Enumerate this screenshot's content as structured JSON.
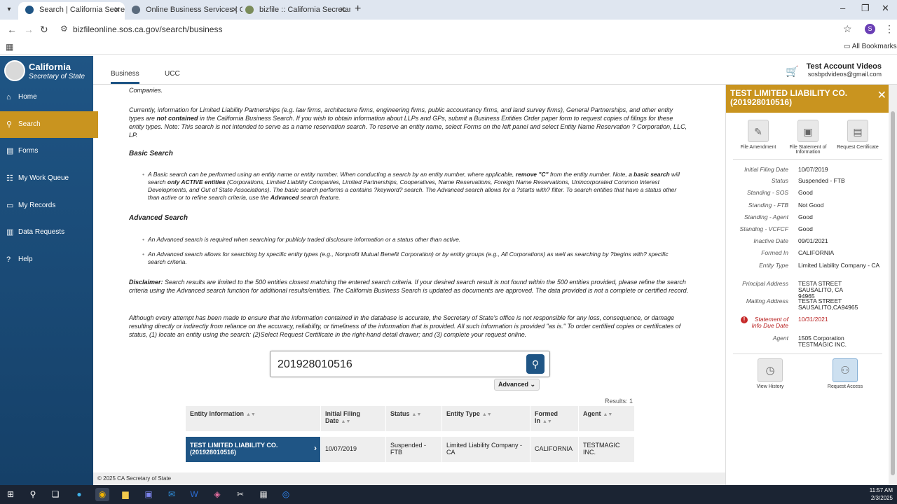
{
  "browser": {
    "tabs": [
      {
        "title": "Search | California Secretary of",
        "active": true
      },
      {
        "title": "Online Business Services | Calif",
        "active": false
      },
      {
        "title": "bizfile :: California Secretary of",
        "active": false
      }
    ],
    "url": "bizfileonline.sos.ca.gov/search/business",
    "profile_initial": "S",
    "all_bookmarks": "All Bookmarks"
  },
  "brand": {
    "name": "California",
    "subtitle": "Secretary of State"
  },
  "sidebar": {
    "items": [
      {
        "label": "Home",
        "icon": "home-icon"
      },
      {
        "label": "Search",
        "icon": "search-icon",
        "active": true
      },
      {
        "label": "Forms",
        "icon": "forms-icon"
      },
      {
        "label": "My Work Queue",
        "icon": "work-queue-icon"
      },
      {
        "label": "My Records",
        "icon": "records-icon"
      },
      {
        "label": "Data Requests",
        "icon": "data-icon"
      },
      {
        "label": "Help",
        "icon": "help-icon"
      }
    ]
  },
  "topnav": {
    "tabs": [
      "Business",
      "UCC"
    ],
    "account_name": "Test Account Videos",
    "account_email": "sosbpdvideos@gmail.com"
  },
  "main": {
    "top_fragment": "Companies.",
    "para1_a": "Currently, information for Limited Liability Partnerships (e.g. law firms, architecture firms, engineering firms, public accountancy firms, and land survey firms), General Partnerships, and other entity types are ",
    "para1_bold": "not contained",
    "para1_b": " in the California Business Search. If you wish to obtain information about LLPs and GPs, submit a Business Entities Order paper form to request copies of filings for these entity types. Note: This search is not intended to serve as a name reservation search. To reserve an entity name, select Forms on the left panel and select Entity Name Reservation ? Corporation, LLC, LP.",
    "basic_heading": "Basic Search",
    "basic_1": "A Basic search can be performed using an entity name or entity number. When conducting a search by an entity number, where applicable, ",
    "basic_b1": "remove \"C\"",
    "basic_2": " from the entity number. Note, ",
    "basic_b2": "a basic search",
    "basic_3": " will search ",
    "basic_b3": "only ACTIVE entities",
    "basic_4": " (Corporations, Limited Liability Companies, Limited Partnerships, Cooperatives, Name Reservations, Foreign Name Reservations, Unincorporated Common Interest Developments, and Out of State Associations). The basic search performs a contains ?keyword? search. The Advanced search allows for a ?starts with? filter. To search entities that have a status other than active or to refine search criteria, use the ",
    "basic_b4": "Advanced",
    "basic_5": " search feature.",
    "adv_heading": "Advanced Search",
    "adv_1": "An Advanced search is required when searching for publicly traded disclosure information or a status other than active.",
    "adv_2": "An Advanced search allows for searching by specific entity types (e.g., Nonprofit Mutual Benefit Corporation) or by entity groups (e.g., All Corporations) as well as searching by ?begins with? specific search criteria.",
    "disclaimer_label": "Disclaimer:",
    "disclaimer": " Search results are limited to the 500 entities closest matching the entered search criteria. If your desired search result is not found within the 500 entities provided, please refine the search criteria using the Advanced search function for additional results/entities. The California Business Search is updated as documents are approved. The data provided is not a complete or certified record.",
    "para_last": "Although every attempt has been made to ensure that the information contained in the database is accurate, the Secretary of State's office is not responsible for any loss, consequence, or damage resulting directly or indirectly from reliance on the accuracy, reliability, or timeliness of the information that is provided. All such information is provided \"as is.\" To order certified copies or certificates of status, (1) locate an entity using the search: (2)Select Request Certificate in the right-hand detail drawer; and (3) complete your request online.",
    "search_value": "201928010516",
    "advanced_label": "Advanced",
    "results_count": "Results: 1"
  },
  "table": {
    "headers": [
      "Entity Information",
      "Initial Filing Date",
      "Status",
      "Entity Type",
      "Formed In",
      "Agent"
    ],
    "rows": [
      [
        "TEST LIMITED LIABILITY CO. (201928010516)",
        "10/07/2019",
        "Suspended - FTB",
        "Limited Liability Company - CA",
        "CALIFORNIA",
        "TESTMAGIC INC."
      ]
    ]
  },
  "footer": "© 2025 CA Secretary of State",
  "drawer": {
    "title": "TEST LIMITED LIABILITY CO. (201928010516)",
    "actions": [
      "File Amendment",
      "File Statement of Information",
      "Request Certificate"
    ],
    "fields": [
      {
        "label": "Initial Filing Date",
        "value": "10/07/2019"
      },
      {
        "label": "Status",
        "value": "Suspended - FTB"
      },
      {
        "label": "Standing - SOS",
        "value": "Good"
      },
      {
        "label": "Standing - FTB",
        "value": "Not Good"
      },
      {
        "label": "Standing - Agent",
        "value": "Good"
      },
      {
        "label": "Standing - VCFCF",
        "value": "Good"
      },
      {
        "label": "Inactive Date",
        "value": "09/01/2021"
      },
      {
        "label": "Formed In",
        "value": "CALIFORNIA"
      },
      {
        "label": "Entity Type",
        "value": "Limited Liability Company - CA"
      },
      {
        "label": "Principal Address",
        "value": "TESTA STREET SAUSALITO, CA 94965"
      },
      {
        "label": "Mailing Address",
        "value": "TESTA STREET SAUSALITO,CA94965"
      },
      {
        "label": "Statement of Info Due Date",
        "value": "10/31/2021",
        "alert": true
      },
      {
        "label": "Agent",
        "value": "1505 Corporation TESTMAGIC INC."
      }
    ],
    "bottom_actions": [
      "View History",
      "Request Access"
    ]
  },
  "taskbar": {
    "time": "11:57 AM",
    "date": "2/3/2025"
  },
  "colors": {
    "sidebar": "#1f5585",
    "accent": "#c9941f",
    "alert": "#c62828"
  }
}
